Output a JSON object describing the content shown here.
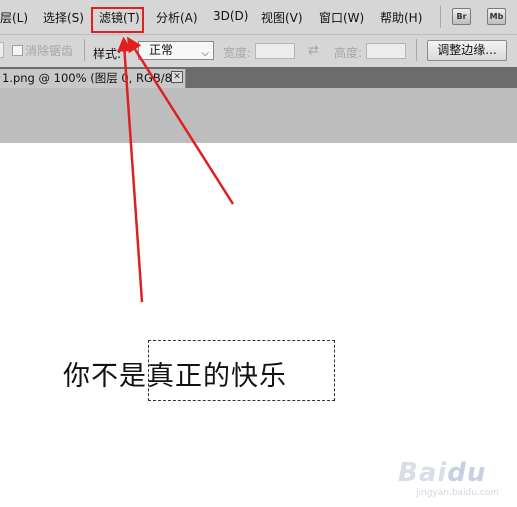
{
  "menubar": {
    "items": [
      "层(L)",
      "选择(S)",
      "滤镜(T)",
      "分析(A)",
      "3D(D)",
      "视图(V)",
      "窗口(W)",
      "帮助(H)"
    ],
    "app_buttons": [
      "Br",
      "Mb"
    ]
  },
  "options": {
    "antialias_label": "消除锯齿",
    "style_label": "样式:",
    "style_value": "正常",
    "width_label": "宽度:",
    "height_label": "高度:",
    "swap_icon": "⇄",
    "refine_button": "调整边缘..."
  },
  "document_tab": {
    "title": "1.png @ 100% (图层 0, RGB/8)",
    "close_glyph": "✕"
  },
  "canvas": {
    "text": "你不是真正的快乐"
  },
  "annotation": {
    "color": "#e02020"
  },
  "watermark": {
    "brand": "Baidu",
    "sub": "jingyan.baidu.com"
  }
}
